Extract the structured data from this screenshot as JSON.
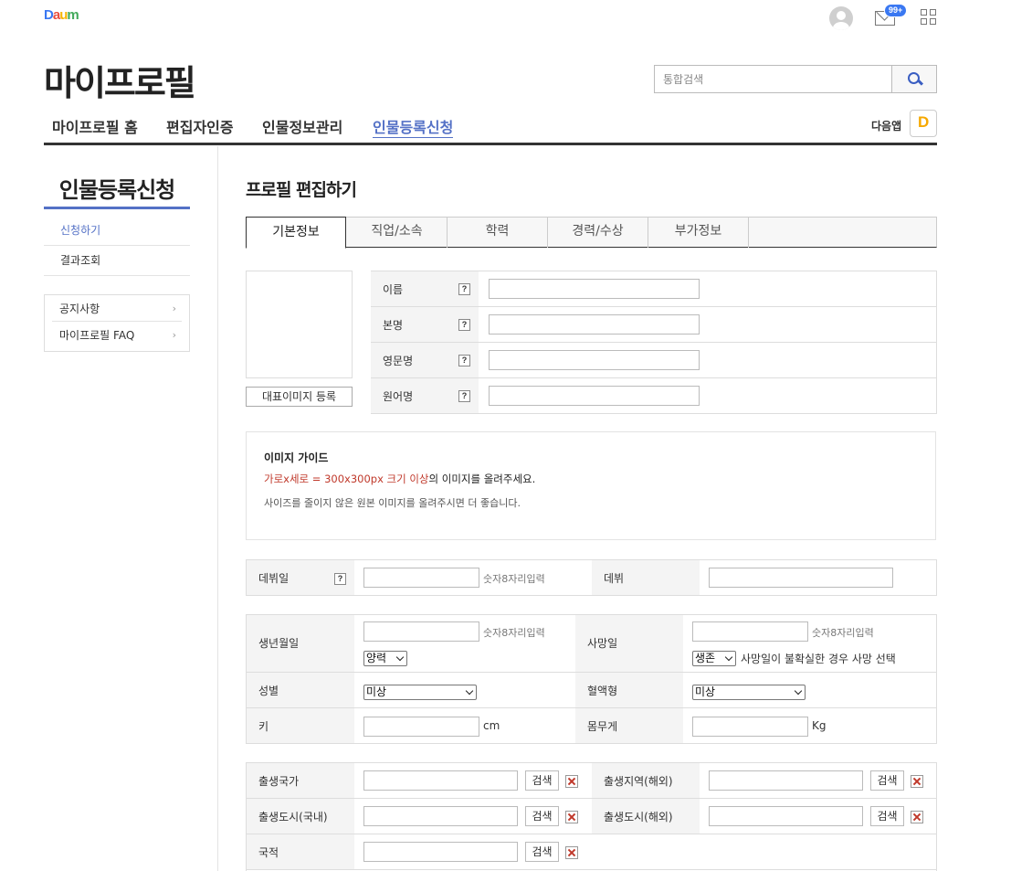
{
  "header": {
    "logo": {
      "c1": "D",
      "c2": "a",
      "c3": "u",
      "c4": "m"
    },
    "mail_badge": "99+",
    "page_title": "마이프로필",
    "search_placeholder": "통합검색"
  },
  "gnb": {
    "items": [
      "마이프로필 홈",
      "편집자인증",
      "인물정보관리",
      "인물등록신청"
    ],
    "daum_app_label": "다음앱",
    "daum_app_icon_letter": "D"
  },
  "sidebar": {
    "title": "인물등록신청",
    "items": [
      "신청하기",
      "결과조회"
    ],
    "links": [
      "공지사항",
      "마이프로필 FAQ"
    ],
    "arrow": "›"
  },
  "main": {
    "section_title": "프로필 편집하기",
    "tabs": [
      "기본정보",
      "직업/소속",
      "학력",
      "경력/수상",
      "부가정보"
    ],
    "image_button": "대표이미지 등록",
    "help_mark": "?",
    "name_rows": [
      "이름",
      "본명",
      "영문명",
      "원어명"
    ],
    "guide": {
      "title": "이미지 가이드",
      "line1_red": "가로x세로 = 300x300px 크기 이상",
      "line1_rest": "의 이미지를 올려주세요.",
      "line2": "사이즈를 줄이지 않은 원본 이미지를 올려주시면 더 좋습니다."
    },
    "debut": {
      "date_label": "데뷔일",
      "hint": "숫자8자리입력",
      "debut_label": "데뷔"
    },
    "personal": {
      "birth_label": "생년월일",
      "birth_hint": "숫자8자리입력",
      "calendar_value": "양력",
      "death_label": "사망일",
      "death_hint": "숫자8자리입력",
      "alive_value": "생존",
      "death_note": "사망일이 불확실한 경우 사망 선택",
      "gender_label": "성별",
      "gender_value": "미상",
      "blood_label": "혈액형",
      "blood_value": "미상",
      "height_label": "키",
      "height_unit": "cm",
      "weight_label": "몸무게",
      "weight_unit": "Kg"
    },
    "birthplace": {
      "search_label": "검색",
      "country_label": "출생국가",
      "region_abroad_label": "출생지역(해외)",
      "city_domestic_label": "출생도시(국내)",
      "city_abroad_label": "출생도시(해외)",
      "nationality_label": "국적"
    }
  }
}
